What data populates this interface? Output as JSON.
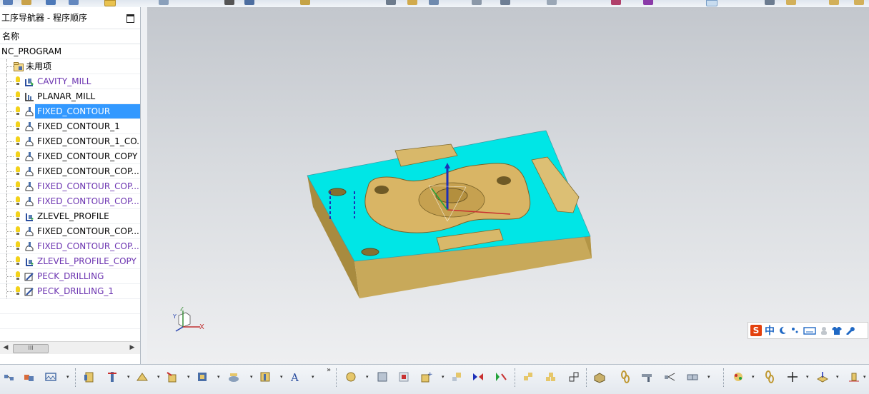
{
  "navigator": {
    "title": "工序导航器 - 程序顺序",
    "column_header": "名称",
    "root": "NC_PROGRAM",
    "unused_group": "未用项",
    "operations": [
      {
        "label": "CAVITY_MILL",
        "icon": "cavity-mill-icon",
        "state": "purple"
      },
      {
        "label": "PLANAR_MILL",
        "icon": "planar-mill-icon",
        "state": "normal"
      },
      {
        "label": "FIXED_CONTOUR",
        "icon": "fixed-contour-icon",
        "state": "selected"
      },
      {
        "label": "FIXED_CONTOUR_1",
        "icon": "fixed-contour-icon",
        "state": "normal"
      },
      {
        "label": "FIXED_CONTOUR_1_CO...",
        "icon": "fixed-contour-icon",
        "state": "normal"
      },
      {
        "label": "FIXED_CONTOUR_COPY",
        "icon": "fixed-contour-icon",
        "state": "normal"
      },
      {
        "label": "FIXED_CONTOUR_COP...",
        "icon": "fixed-contour-icon",
        "state": "normal"
      },
      {
        "label": "FIXED_CONTOUR_COP...",
        "icon": "fixed-contour-icon",
        "state": "purple"
      },
      {
        "label": "FIXED_CONTOUR_COP...",
        "icon": "fixed-contour-icon",
        "state": "purple"
      },
      {
        "label": "ZLEVEL_PROFILE",
        "icon": "zlevel-profile-icon",
        "state": "normal"
      },
      {
        "label": "FIXED_CONTOUR_COP...",
        "icon": "fixed-contour-icon",
        "state": "normal"
      },
      {
        "label": "FIXED_CONTOUR_COP...",
        "icon": "fixed-contour-icon",
        "state": "purple"
      },
      {
        "label": "ZLEVEL_PROFILE_COPY",
        "icon": "zlevel-profile-icon",
        "state": "purple"
      },
      {
        "label": "PECK_DRILLING",
        "icon": "peck-drilling-icon",
        "state": "purple"
      },
      {
        "label": "PECK_DRILLING_1",
        "icon": "peck-drilling-icon",
        "state": "purple"
      }
    ],
    "scroll_thumb": "III"
  },
  "viewport": {
    "triad": {
      "x_label": "X",
      "y_label": "Y",
      "z_label": "Z"
    },
    "colors": {
      "part_top": "#00e6e6",
      "part_body": "#c8a95a",
      "part_dark": "#8f7a3a"
    }
  },
  "ime": {
    "logo": "S",
    "mode": "中"
  },
  "colors": {
    "selection": "#3399ff",
    "unfinished_text": "#6b33b0",
    "bulb": "#f3d21a"
  }
}
